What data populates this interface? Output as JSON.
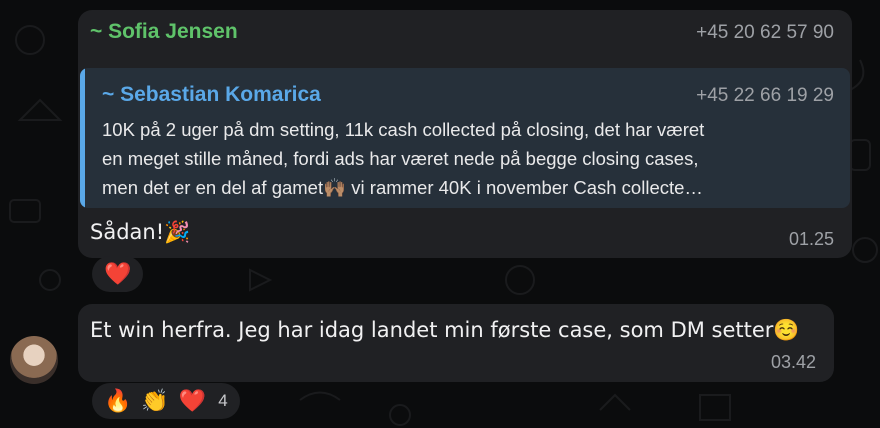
{
  "message1": {
    "sender_name": "~ Sofia Jensen",
    "sender_phone": "+45 20 62 57 90",
    "reply": {
      "name": "~ Sebastian Komarica",
      "phone": "+45 22 66 19 29",
      "lines": [
        "10K på 2 uger på dm setting, 11k cash collected på closing, det har været",
        "en meget stille måned, fordi ads har været nede på begge closing cases,",
        "men det er en del af gamet🙌🏽 vi rammer 40K i november Cash collecte…"
      ]
    },
    "text": "Sådan!🎉",
    "time": "01.25",
    "reactions": [
      "❤️"
    ]
  },
  "message2": {
    "text": "Et win herfra. Jeg har idag landet min første case, som DM setter☺️",
    "time": "03.42",
    "reactions": [
      "🔥",
      "👏",
      "❤️"
    ],
    "reaction_count": "4"
  },
  "colors": {
    "background": "#0b0c0d",
    "bubble": "#202124",
    "sender_accent": "#5fc36a",
    "reply_accent": "#5aa8e8",
    "reply_bg": "#26303a"
  }
}
